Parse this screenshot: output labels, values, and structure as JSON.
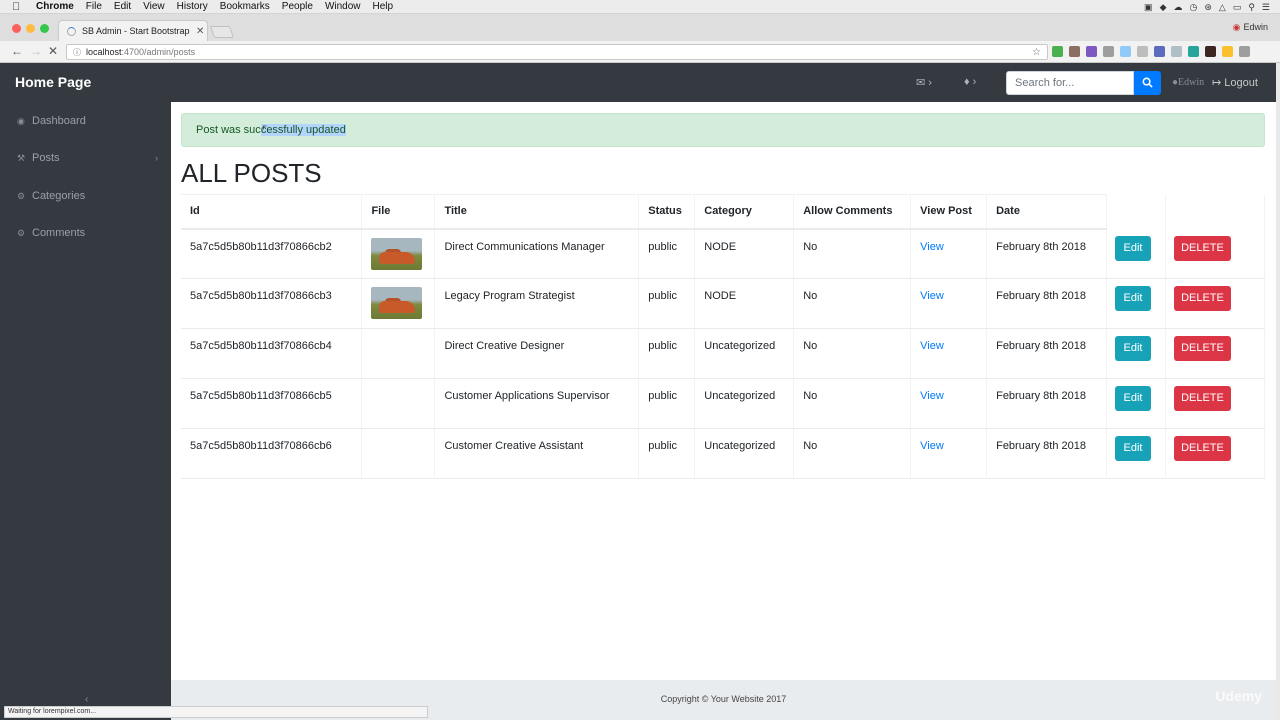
{
  "mac_menu": {
    "app": "Chrome",
    "items": [
      "File",
      "Edit",
      "View",
      "History",
      "Bookmarks",
      "People",
      "Window",
      "Help"
    ]
  },
  "browser": {
    "tab_title": "SB Admin - Start Bootstrap Te",
    "url_host": "localhost",
    "url_path": ":4700/admin/posts",
    "profile_name": "Edwin",
    "status_text": "Waiting for lorempixel.com..."
  },
  "navbar": {
    "brand": "Home Page",
    "search_placeholder": "Search for...",
    "user": "Edwin",
    "logout": "Logout"
  },
  "sidebar": {
    "items": [
      {
        "label": "Dashboard",
        "icon": "dashboard-icon"
      },
      {
        "label": "Posts",
        "icon": "wrench-icon"
      },
      {
        "label": "Categories",
        "icon": "gear-icon"
      },
      {
        "label": "Comments",
        "icon": "gear-icon"
      }
    ]
  },
  "alert": {
    "prefix": "Post was suc",
    "highlight": "cessfully updated"
  },
  "page_title": "ALL POSTS",
  "table": {
    "headers": [
      "Id",
      "File",
      "Title",
      "Status",
      "Category",
      "Allow Comments",
      "View Post",
      "Date"
    ],
    "rows": [
      {
        "id": "5a7c5d5b80b11d3f70866cb2",
        "has_image": true,
        "title": "Direct Communications Manager",
        "status": "public",
        "category": "NODE",
        "allow_comments": "No",
        "view": "View",
        "date": "February 8th 2018"
      },
      {
        "id": "5a7c5d5b80b11d3f70866cb3",
        "has_image": true,
        "title": "Legacy Program Strategist",
        "status": "public",
        "category": "NODE",
        "allow_comments": "No",
        "view": "View",
        "date": "February 8th 2018"
      },
      {
        "id": "5a7c5d5b80b11d3f70866cb4",
        "has_image": false,
        "title": "Direct Creative Designer",
        "status": "public",
        "category": "Uncategorized",
        "allow_comments": "No",
        "view": "View",
        "date": "February 8th 2018"
      },
      {
        "id": "5a7c5d5b80b11d3f70866cb5",
        "has_image": false,
        "title": "Customer Applications Supervisor",
        "status": "public",
        "category": "Uncategorized",
        "allow_comments": "No",
        "view": "View",
        "date": "February 8th 2018"
      },
      {
        "id": "5a7c5d5b80b11d3f70866cb6",
        "has_image": false,
        "title": "Customer Creative Assistant",
        "status": "public",
        "category": "Uncategorized",
        "allow_comments": "No",
        "view": "View",
        "date": "February 8th 2018"
      }
    ],
    "edit_label": "Edit",
    "delete_label": "DELETE"
  },
  "footer": {
    "copyright": "Copyright © Your Website 2017"
  },
  "watermark": "Udemy",
  "colors": {
    "navbar_bg": "#343a40",
    "alert_bg": "#d4edda",
    "edit_button": "#17a2b8",
    "delete_button": "#dc3545",
    "link": "#007bff"
  }
}
